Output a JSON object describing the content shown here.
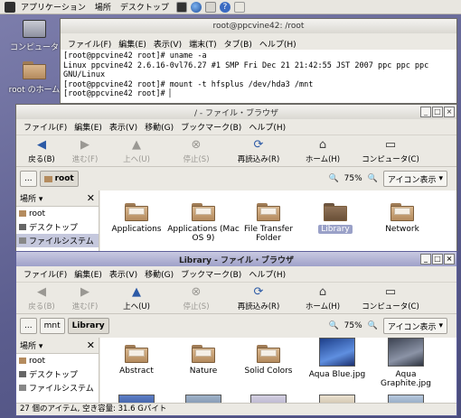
{
  "topbar": {
    "applications": "アプリケーション",
    "places": "場所",
    "desktop": "デスクトップ"
  },
  "desktop_icons": [
    {
      "label": "コンピュータ"
    },
    {
      "label": "root のホーム"
    }
  ],
  "terminal": {
    "title": "root@ppcvine42: /root",
    "menus": [
      "ファイル(F)",
      "編集(E)",
      "表示(V)",
      "端末(T)",
      "タブ(B)",
      "ヘルプ(H)"
    ],
    "lines": [
      "[root@ppcvine42 root]# uname -a",
      "Linux ppcvine42 2.6.16-0vl76.27 #1 SMP Fri Dec 21 21:42:55 JST 2007 ppc ppc ppc",
      "GNU/Linux",
      "[root@ppcvine42 root]# mount -t hfsplus /dev/hda3 /mnt",
      "[root@ppcvine42 root]# ▏"
    ]
  },
  "browser1": {
    "title": "/ - ファイル・ブラウザ",
    "menus": [
      "ファイル(F)",
      "編集(E)",
      "表示(V)",
      "移動(G)",
      "ブックマーク(B)",
      "ヘルプ(H)"
    ],
    "toolbar": {
      "back": "戻る(B)",
      "forward": "進む(F)",
      "up": "上へ(U)",
      "stop": "停止(S)",
      "reload": "再読込み(R)",
      "home": "ホーム(H)",
      "computer": "コンピュータ(C)"
    },
    "breadcrumb": [
      "...",
      "root"
    ],
    "zoom": "75%",
    "view": "アイコン表示",
    "sidebar": {
      "header": "場所",
      "items": [
        "root",
        "デスクトップ",
        "ファイルシステム"
      ]
    },
    "files": [
      "Applications",
      "Applications (Mac OS 9)",
      "File Transfer Folder",
      "Library",
      "Network"
    ]
  },
  "browser2": {
    "title": "Library - ファイル・ブラウザ",
    "menus": [
      "ファイル(F)",
      "編集(E)",
      "表示(V)",
      "移動(G)",
      "ブックマーク(B)",
      "ヘルプ(H)"
    ],
    "toolbar": {
      "back": "戻る(B)",
      "forward": "進む(F)",
      "up": "上へ(U)",
      "stop": "停止(S)",
      "reload": "再読込み(R)",
      "home": "ホーム(H)",
      "computer": "コンピュータ(C)"
    },
    "breadcrumb": [
      "...",
      "mnt",
      "Library"
    ],
    "zoom": "75%",
    "view": "アイコン表示",
    "sidebar": {
      "header": "場所",
      "items": [
        "root",
        "デスクトップ",
        "ファイルシステム"
      ]
    },
    "files": [
      "Abstract",
      "Nature",
      "Solid Colors",
      "Aqua Blue.jpg",
      "Aqua Graphite.jpg"
    ],
    "status": "27 個のアイテム, 空き容量: 31.6 Gバイト"
  }
}
